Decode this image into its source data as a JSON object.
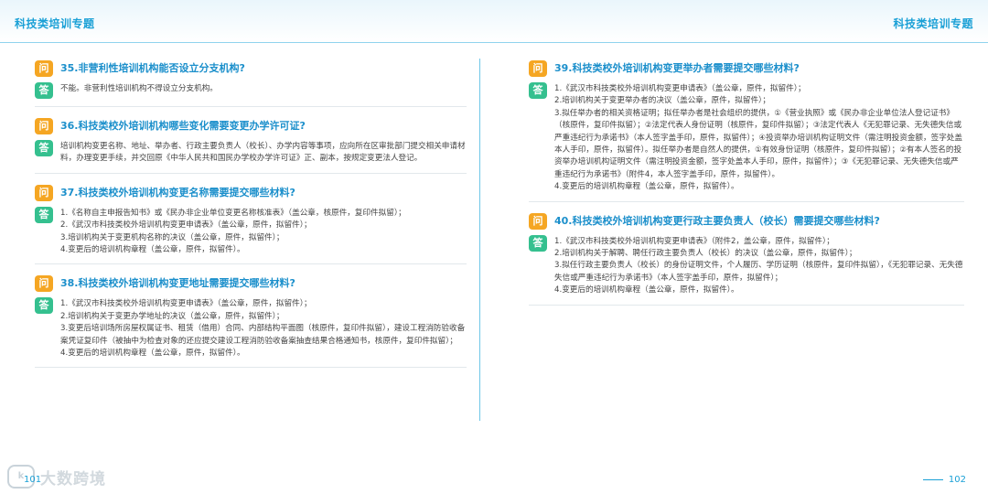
{
  "header": {
    "left_title": "科技类培训专题",
    "right_title": "科技类培训专题"
  },
  "badges": {
    "q": "问",
    "a": "答"
  },
  "left_column": [
    {
      "question": "35.非营利性培训机构能否设立分支机构?",
      "answer": [
        "不能。非营利性培训机构不得设立分支机构。"
      ]
    },
    {
      "question": "36.科技类校外培训机构哪些变化需要变更办学许可证?",
      "answer": [
        "培训机构变更名称、地址、举办者、行政主要负责人（校长）、办学内容等事项，应向所在区审批部门提交相关申请材料，办理变更手续，并交回原《中华人民共和国民办学校办学许可证》正、副本，按规定变更法人登记。"
      ]
    },
    {
      "question": "37.科技类校外培训机构变更名称需要提交哪些材料?",
      "answer": [
        "1.《名称自主申报告知书》或《民办非企业单位变更名称核准表》（盖公章，核原件，复印件拟留）；",
        "2.《武汉市科技类校外培训机构变更申请表》（盖公章，原件，拟留件）；",
        "3.培训机构关于变更机构名称的决议（盖公章，原件，拟留件）；",
        "4.变更后的培训机构章程（盖公章，原件，拟留件）。"
      ]
    },
    {
      "question": "38.科技类校外培训机构变更地址需要提交哪些材料?",
      "answer": [
        "1.《武汉市科技类校外培训机构变更申请表》（盖公章，原件，拟留件）；",
        "2.培训机构关于变更办学地址的决议（盖公章，原件，拟留件）；",
        "3.变更后培训场所房屋权属证书、租赁（借用）合同、内部结构平面图（核原件，复印件拟留），建设工程消防验收备案凭证复印件（被抽中为检查对象的还应提交建设工程消防验收备案抽查结果合格通知书，核原件，复印件拟留）；",
        "4.变更后的培训机构章程（盖公章，原件，拟留件）。"
      ]
    }
  ],
  "right_column": [
    {
      "question": "39.科技类校外培训机构变更举办者需要提交哪些材料?",
      "answer": [
        "1.《武汉市科技类校外培训机构变更申请表》（盖公章，原件，拟留件）；",
        "2.培训机构关于变更举办者的决议（盖公章，原件，拟留件）；",
        "3.拟任举办者的相关资格证明；拟任举办者是社会组织的提供，①《营业执照》或《民办非企业单位法人登记证书》（核原件，复印件拟留）；②法定代表人身份证明（核原件，复印件拟留）；③法定代表人《无犯罪记录、无失德失信或严重违纪行为承诺书》（本人签字盖手印，原件，拟留件）；④投资举办培训机构证明文件（需注明投资金额，签字处盖本人手印，原件，拟留件）。拟任举办者是自然人的提供，①有效身份证明（核原件，复印件拟留）；②有本人签名的投资举办培训机构证明文件（需注明投资金额，签字处盖本人手印，原件，拟留件）；③《无犯罪记录、无失德失信或严重违纪行为承诺书》（附件4，本人签字盖手印，原件，拟留件）。",
        "4.变更后的培训机构章程（盖公章，原件，拟留件）。"
      ]
    },
    {
      "question": "40.科技类校外培训机构变更行政主要负责人（校长）需要提交哪些材料?",
      "answer": [
        "1.《武汉市科技类校外培训机构变更申请表》（附件2，盖公章，原件，拟留件）；",
        "2.培训机构关于解聘、聘任行政主要负责人（校长）的决议（盖公章，原件，拟留件）；",
        "3.拟任行政主要负责人（校长）的身份证明文件，个人履历、学历证明（核原件，复印件拟留），《无犯罪记录、无失德失信或严重违纪行为承诺书》（本人签字盖手印，原件，拟留件）；",
        "4.变更后的培训机构章程（盖公章，原件，拟留件）。"
      ]
    }
  ],
  "footer": {
    "page_left": "101",
    "page_right": "102",
    "watermark_text": "大数跨境",
    "watermark_logo": "k"
  }
}
